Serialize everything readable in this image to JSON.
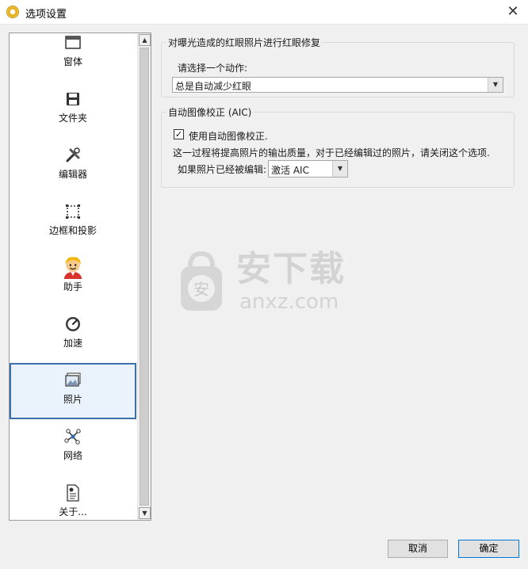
{
  "window": {
    "title": "选项设置",
    "close_glyph": "✕"
  },
  "nav": {
    "items": [
      {
        "label": "窗体",
        "icon": "window-icon"
      },
      {
        "label": "文件夹",
        "icon": "save-disk-icon"
      },
      {
        "label": "编辑器",
        "icon": "tools-icon"
      },
      {
        "label": "边框和投影",
        "icon": "frame-icon"
      },
      {
        "label": "助手",
        "icon": "assistant-avatar-icon"
      },
      {
        "label": "加速",
        "icon": "speedometer-icon"
      },
      {
        "label": "照片",
        "icon": "photo-icon"
      },
      {
        "label": "网络",
        "icon": "network-icon"
      },
      {
        "label": "关于...",
        "icon": "about-document-icon"
      }
    ],
    "selected": "照片"
  },
  "redeye_group": {
    "title": "对曝光造成的红眼照片进行红眼修复",
    "prompt": "请选择一个动作:",
    "selected_action": "总是自动减少红眼"
  },
  "aic_group": {
    "title": "自动图像校正 (AIC)",
    "checkbox_label": "使用自动图像校正.",
    "checked": true,
    "check_glyph": "✓",
    "description": "这一过程将提高照片的输出质量，对于已经编辑过的照片，请关闭这个选项.",
    "edited_label": "如果照片已经被编辑:",
    "edited_selected": "激活 AIC"
  },
  "watermark": {
    "text_cn": "安下载",
    "text_en": "anxz.com",
    "shield_char": "安"
  },
  "buttons": {
    "cancel": "取消",
    "ok": "确定"
  },
  "glyphs": {
    "scroll_up": "▲",
    "scroll_down": "▼",
    "dropdown": "▼"
  }
}
